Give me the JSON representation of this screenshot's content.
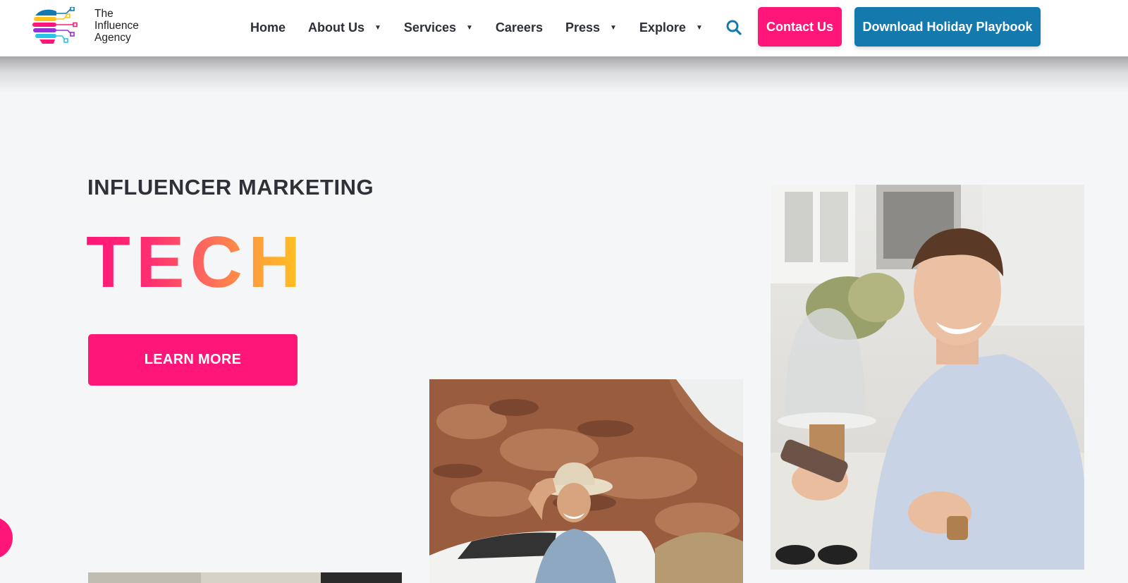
{
  "brand": {
    "name_lines": [
      "The",
      "Influence",
      "Agency"
    ],
    "colors": {
      "pink": "#ff1678",
      "blue": "#1479ad",
      "yellow": "#ffc41c",
      "cyan": "#29c4e6",
      "purple": "#9b2fd6"
    }
  },
  "nav": {
    "items": [
      {
        "label": "Home",
        "has_dropdown": false
      },
      {
        "label": "About Us",
        "has_dropdown": true
      },
      {
        "label": "Services",
        "has_dropdown": true
      },
      {
        "label": "Careers",
        "has_dropdown": false
      },
      {
        "label": "Press",
        "has_dropdown": true
      },
      {
        "label": "Explore",
        "has_dropdown": true
      }
    ],
    "search_icon": "search-icon",
    "caret_icon": "caret-down-icon"
  },
  "header": {
    "contact_label": "Contact Us",
    "playbook_label": "Download Holiday Playbook"
  },
  "hero": {
    "eyebrow": "INFLUENCER MARKETING",
    "title": "TECH",
    "cta_label": "LEARN MORE"
  },
  "colors": {
    "header_bg": "#ffffff",
    "page_bg": "#f5f6f8",
    "nav_text": "#2d3037",
    "title_gradient": [
      "#ff1678",
      "#ffc41c"
    ]
  }
}
